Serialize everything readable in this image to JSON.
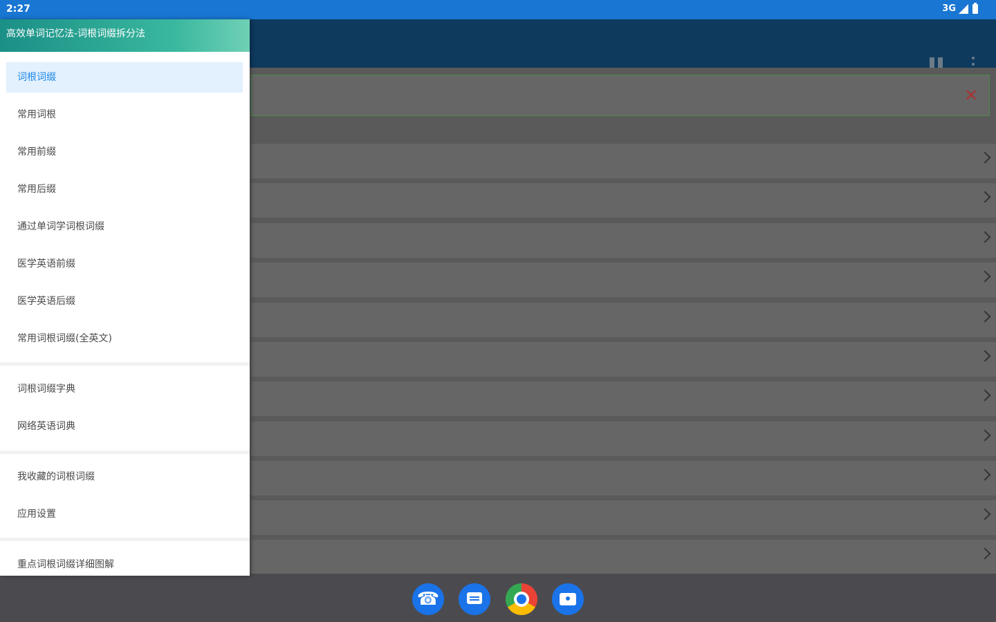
{
  "status": {
    "time": "2:27",
    "network": "3G"
  },
  "drawer": {
    "title": "高效单词记忆法-词根词缀拆分法",
    "section1": [
      "词根词缀",
      "常用词根",
      "常用前缀",
      "常用后缀",
      "通过单词学词根词缀",
      "医学英语前缀",
      "医学英语后缀",
      "常用词根词缀(全英文)"
    ],
    "section2": [
      "词根词缀字典",
      "网络英语词典"
    ],
    "section3": [
      "我收藏的词根词缀",
      "应用设置"
    ],
    "section4": [
      "重点词根词缀详细图解"
    ]
  },
  "colors": {
    "status_bar": "#1976d2",
    "active_item_bg": "#e3f0fd",
    "active_item_text": "#1e88e5"
  }
}
